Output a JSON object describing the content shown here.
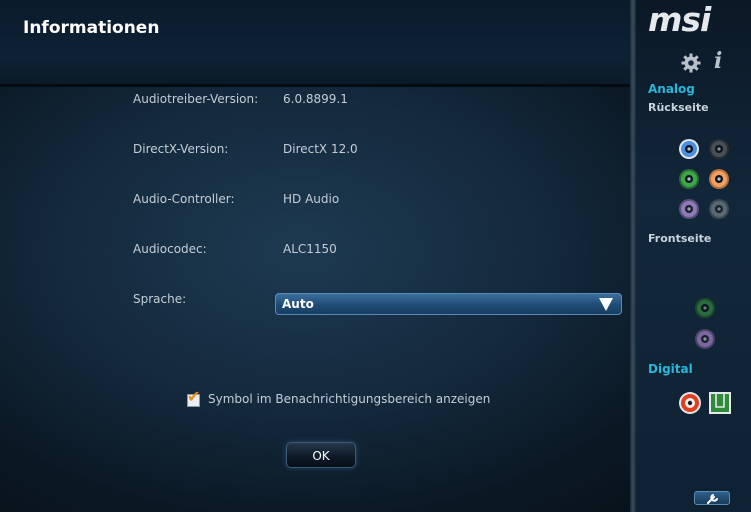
{
  "window": {
    "title": "Informationen"
  },
  "info_rows": [
    {
      "label": "Audiotreiber-Version:",
      "value": "6.0.8899.1"
    },
    {
      "label": "DirectX-Version:",
      "value": "DirectX 12.0"
    },
    {
      "label": "Audio-Controller:",
      "value": "HD Audio"
    },
    {
      "label": "Audiocodec:",
      "value": "ALC1150"
    }
  ],
  "language": {
    "label": "Sprache:",
    "value": "Auto"
  },
  "tray_option": {
    "label": "Symbol im Benachrichtigungsbereich anzeigen",
    "checked": true
  },
  "buttons": {
    "ok": "OK"
  },
  "sidebar": {
    "logo": "msi",
    "info_glyph": "i",
    "analog_title": "Analog",
    "rear_title": "Rückseite",
    "front_title": "Frontseite",
    "digital_title": "Digital"
  },
  "colors": {
    "accent": "#29b6d8",
    "jack_blue": "#4a8fe0",
    "jack_black": "#4a4f55",
    "jack_green": "#3aa84a",
    "jack_orange": "#f0a060",
    "jack_purple": "#8e7ab8",
    "jack_gray": "#5a6874",
    "spdif_red": "#e04020",
    "optical_green": "#2f8a3a"
  }
}
